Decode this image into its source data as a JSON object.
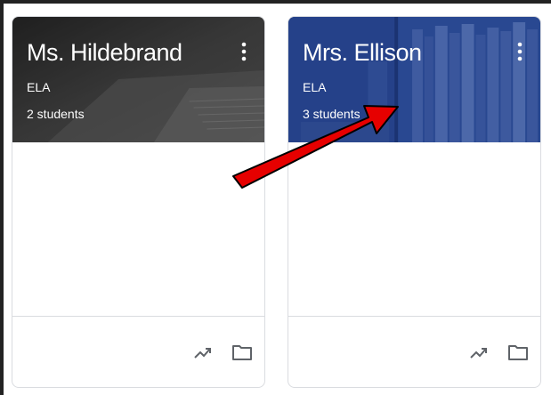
{
  "classes": [
    {
      "teacher": "Ms. Hildebrand",
      "section": "ELA",
      "students": "2 students",
      "banner_color": "#3d3d3d"
    },
    {
      "teacher": "Mrs. Ellison",
      "section": "ELA",
      "students": "3 students",
      "banner_color": "#2f4f9a"
    }
  ],
  "icons": {
    "menu": "more-vert-icon",
    "trend": "trending-up-icon",
    "folder": "folder-icon"
  },
  "annotation_color": "#e60000"
}
